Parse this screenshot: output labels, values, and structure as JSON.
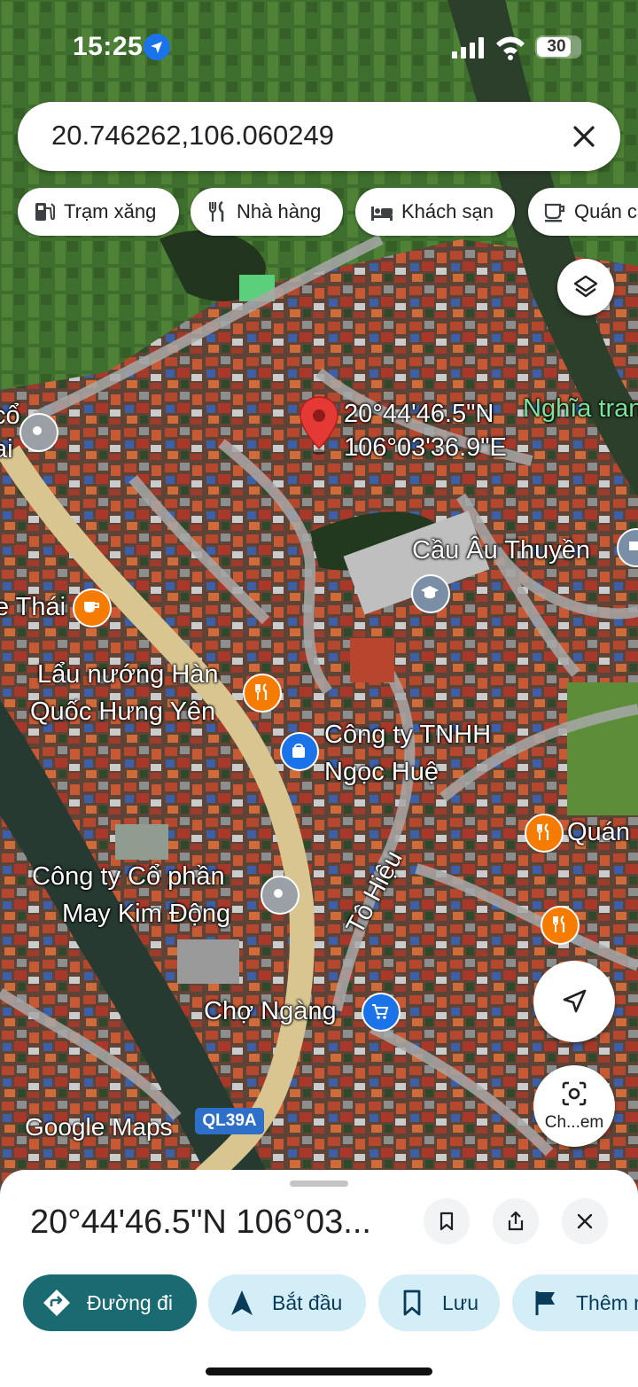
{
  "status_bar": {
    "time": "15:25",
    "battery": "30"
  },
  "search": {
    "query": "20.746262,106.060249"
  },
  "chips": [
    {
      "label": "Trạm xăng",
      "icon": "gas-station-icon"
    },
    {
      "label": "Nhà hàng",
      "icon": "restaurant-icon"
    },
    {
      "label": "Khách sạn",
      "icon": "hotel-icon"
    },
    {
      "label": "Quán cà phê",
      "icon": "cafe-icon"
    }
  ],
  "map": {
    "pin": {
      "lat": "20°44'46.5\"N",
      "lng": "106°03'36.9\"E"
    },
    "labels": {
      "nghia_trang": "Nghĩa trang",
      "cau_au_thuyen": "Cầu Âu Thuyền",
      "thai": "e Thái",
      "lau_1": "Lẩu nướng Hàn",
      "lau_2": "Quốc Hưng Yên",
      "cong_ty_1": "Công ty TNHH",
      "cong_ty_2": "Ngọc Huệ",
      "quan": "Quán",
      "may_1": "Công ty Cổ phần",
      "may_2": "May Kim Động",
      "to_hieu": "Tô Hiệu",
      "cho_ngang": "Chợ Ngàng",
      "left_1": "cổ",
      "left_2": "ai"
    },
    "google_logo": "Google Maps",
    "road_badge": "QL39A",
    "camera_label": "Ch...em"
  },
  "sheet": {
    "title": "20°44'46.5\"N 106°03...",
    "actions": [
      {
        "label": "Đường đi",
        "icon": "directions-icon"
      },
      {
        "label": "Bắt đầu",
        "icon": "navigation-icon"
      },
      {
        "label": "Lưu",
        "icon": "bookmark-icon"
      },
      {
        "label": "Thêm nhãn",
        "icon": "flag-icon"
      }
    ]
  },
  "colors": {
    "accent": "#1a6a72",
    "secondary": "#d3eef6",
    "pin": "#e53935",
    "poi_orange": "#f57c00",
    "poi_blue": "#1a73e8"
  }
}
